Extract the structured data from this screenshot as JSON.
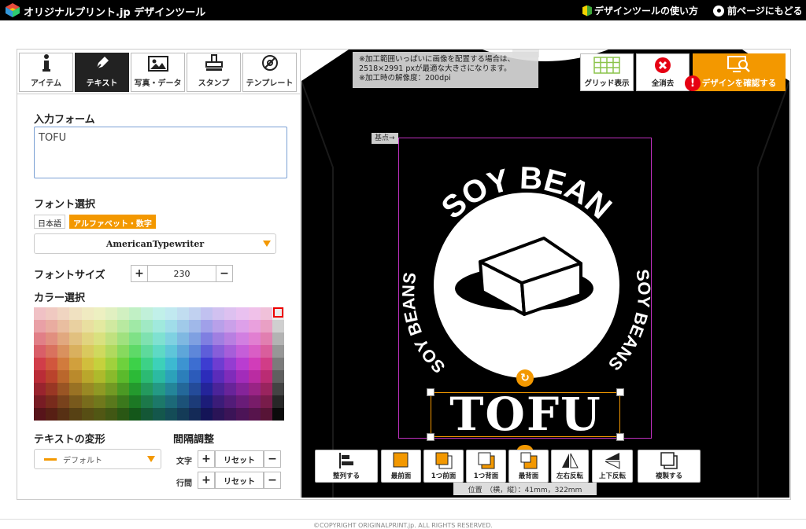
{
  "header": {
    "brand": "オリジナルプリント.jp デザインツール",
    "howto": "デザインツールの使い方",
    "prev_page": "前ページにもどる"
  },
  "tabs": [
    {
      "label": "アイテム",
      "icon": "info-icon",
      "active": false
    },
    {
      "label": "テキスト",
      "icon": "pen-icon",
      "active": true
    },
    {
      "label": "写真・データ",
      "icon": "image-icon",
      "active": false
    },
    {
      "label": "スタンプ",
      "icon": "stamp-icon",
      "active": false
    },
    {
      "label": "テンプレート",
      "icon": "template-icon",
      "active": false
    }
  ],
  "form": {
    "input_label": "入力フォーム",
    "input_value": "TOFU",
    "font_label": "フォント選択",
    "font_japanese": "日本語",
    "font_alpha": "アルファベット・数字",
    "font_selected": "AmericanTypewriter",
    "size_label": "フォントサイズ",
    "size_value": "230",
    "plus": "+",
    "minus": "−",
    "color_label": "カラー選択",
    "transform_label": "テキストの変形",
    "transform_value": "デフォルト",
    "spacing_label": "間隔調整",
    "char_label": "文字",
    "line_label": "行間",
    "reset": "リセット"
  },
  "canvas": {
    "note": [
      "※加工範囲いっぱいに画像を配置する場合は、",
      "2518×2991 pxが最適な大きさになります。",
      "※加工時の解像度：200dpi"
    ],
    "base_point": "基点→",
    "grid_button": "グリッド表示",
    "clear_button": "全消去",
    "confirm_button": "デザインを確認する",
    "warn": "!",
    "design_top": "SOY BEAN",
    "design_left": "SOY BEANS",
    "design_right": "SOY BEANS",
    "design_text": "TOFU",
    "position": "位置　（横，縦）：41mm，322mm"
  },
  "bottom_tools": [
    {
      "label": "整列する",
      "icon": "align-icon"
    },
    {
      "label": "最前面",
      "icon": "front-icon"
    },
    {
      "label": "1つ前面",
      "icon": "forward-icon"
    },
    {
      "label": "1つ背面",
      "icon": "backward-icon"
    },
    {
      "label": "最背面",
      "icon": "back-icon"
    },
    {
      "label": "左右反転",
      "icon": "flip-h-icon"
    },
    {
      "label": "上下反転",
      "icon": "flip-v-icon"
    },
    {
      "label": "複製する",
      "icon": "duplicate-icon"
    }
  ],
  "footer": {
    "copyright": "©COPYRIGHT ORIGINALPRINT.jp. ALL RIGHTS RESERVED."
  },
  "colors": {
    "accent": "#f39800",
    "warn": "#e60012",
    "selection_box": "#c030c0"
  }
}
